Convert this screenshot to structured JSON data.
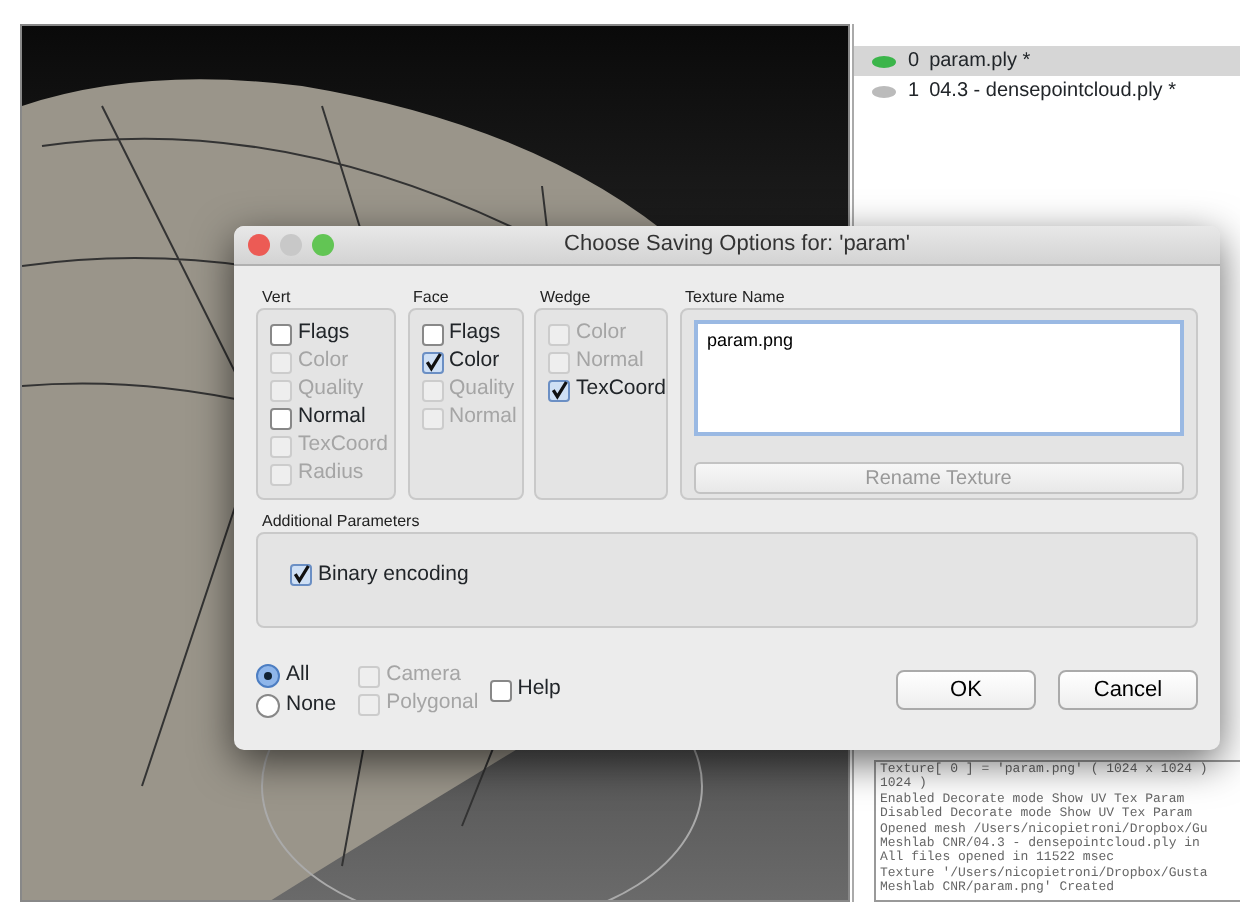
{
  "layers": [
    {
      "index": "0",
      "name": "param.ply *",
      "selected": true,
      "visible": true
    },
    {
      "index": "1",
      "name": "04.3 - densepointcloud.ply *",
      "selected": false,
      "visible": false
    }
  ],
  "log": [
    "Texture[ 0 ] = 'param.png' ( 1024 x 1024 )",
    "1024 )",
    "Enabled Decorate mode Show UV Tex Param",
    "Disabled Decorate mode Show UV Tex Param",
    "Opened mesh /Users/nicopietroni/Dropbox/Gu",
    "Meshlab CNR/04.3 - densepointcloud.ply in",
    "All files opened in 11522 msec",
    "Texture '/Users/nicopietroni/Dropbox/Gusta",
    "Meshlab CNR/param.png' Created"
  ],
  "dialog": {
    "title": "Choose Saving Options for: 'param'",
    "groups": [
      {
        "title": "Vert",
        "options": [
          {
            "label": "Flags",
            "checked": false,
            "disabled": false
          },
          {
            "label": "Color",
            "checked": false,
            "disabled": true
          },
          {
            "label": "Quality",
            "checked": false,
            "disabled": true
          },
          {
            "label": "Normal",
            "checked": false,
            "disabled": false
          },
          {
            "label": "TexCoord",
            "checked": false,
            "disabled": true
          },
          {
            "label": "Radius",
            "checked": false,
            "disabled": true
          }
        ]
      },
      {
        "title": "Face",
        "options": [
          {
            "label": "Flags",
            "checked": false,
            "disabled": false
          },
          {
            "label": "Color",
            "checked": true,
            "disabled": false
          },
          {
            "label": "Quality",
            "checked": false,
            "disabled": true
          },
          {
            "label": "Normal",
            "checked": false,
            "disabled": true
          }
        ]
      },
      {
        "title": "Wedge",
        "options": [
          {
            "label": "Color",
            "checked": false,
            "disabled": true
          },
          {
            "label": "Normal",
            "checked": false,
            "disabled": true
          },
          {
            "label": "TexCoord",
            "checked": true,
            "disabled": false
          }
        ]
      }
    ],
    "texture": {
      "title": "Texture Name",
      "value": "param.png",
      "button": "Rename Texture",
      "button_disabled": true
    },
    "additional": {
      "title": "Additional Parameters",
      "options": [
        {
          "label": "Binary encoding",
          "checked": true,
          "disabled": false
        }
      ]
    },
    "radios": [
      {
        "label": "All",
        "selected": true
      },
      {
        "label": "None",
        "selected": false
      }
    ],
    "extra": [
      {
        "label": "Camera",
        "checked": false,
        "disabled": true
      },
      {
        "label": "Polygonal",
        "checked": false,
        "disabled": true
      }
    ],
    "help": {
      "label": "Help",
      "checked": false,
      "disabled": false
    },
    "buttons": [
      "OK",
      "Cancel"
    ]
  }
}
